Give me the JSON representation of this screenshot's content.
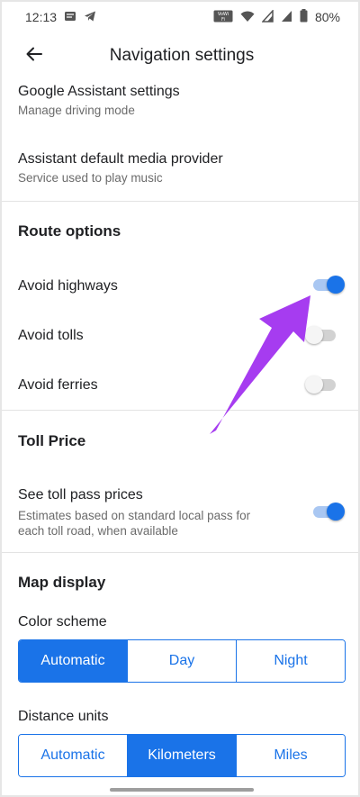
{
  "status_bar": {
    "time": "12:13",
    "battery": "80%",
    "left_icons": [
      "message-icon",
      "telegram-icon"
    ],
    "right_icons": [
      "vowifi-icon",
      "wifi-icon",
      "signal-icon",
      "signal-icon",
      "battery-icon"
    ]
  },
  "app_bar": {
    "title": "Navigation settings",
    "back_icon": "back-arrow-icon"
  },
  "rows": {
    "google_assistant": {
      "title": "Google Assistant settings",
      "subtitle": "Manage driving mode"
    },
    "assistant_media": {
      "title": "Assistant default media provider",
      "subtitle": "Service used to play music"
    }
  },
  "route_options": {
    "title": "Route options",
    "items": [
      {
        "label": "Avoid highways",
        "on": true
      },
      {
        "label": "Avoid tolls",
        "on": false
      },
      {
        "label": "Avoid ferries",
        "on": false
      }
    ]
  },
  "toll_price": {
    "title": "Toll Price",
    "item": {
      "label": "See toll pass prices",
      "subtitle_line1": "Estimates based on standard local pass for",
      "subtitle_line2": "each toll road, when available",
      "on": true
    }
  },
  "map_display": {
    "title": "Map display",
    "color_scheme": {
      "label": "Color scheme",
      "options": [
        "Automatic",
        "Day",
        "Night"
      ],
      "selected": "Automatic"
    },
    "distance_units": {
      "label": "Distance units",
      "options": [
        "Automatic",
        "Kilometers",
        "Miles"
      ],
      "selected": "Kilometers"
    }
  },
  "colors": {
    "accent": "#1a73e8",
    "annotation_arrow": "#a63cf0"
  }
}
